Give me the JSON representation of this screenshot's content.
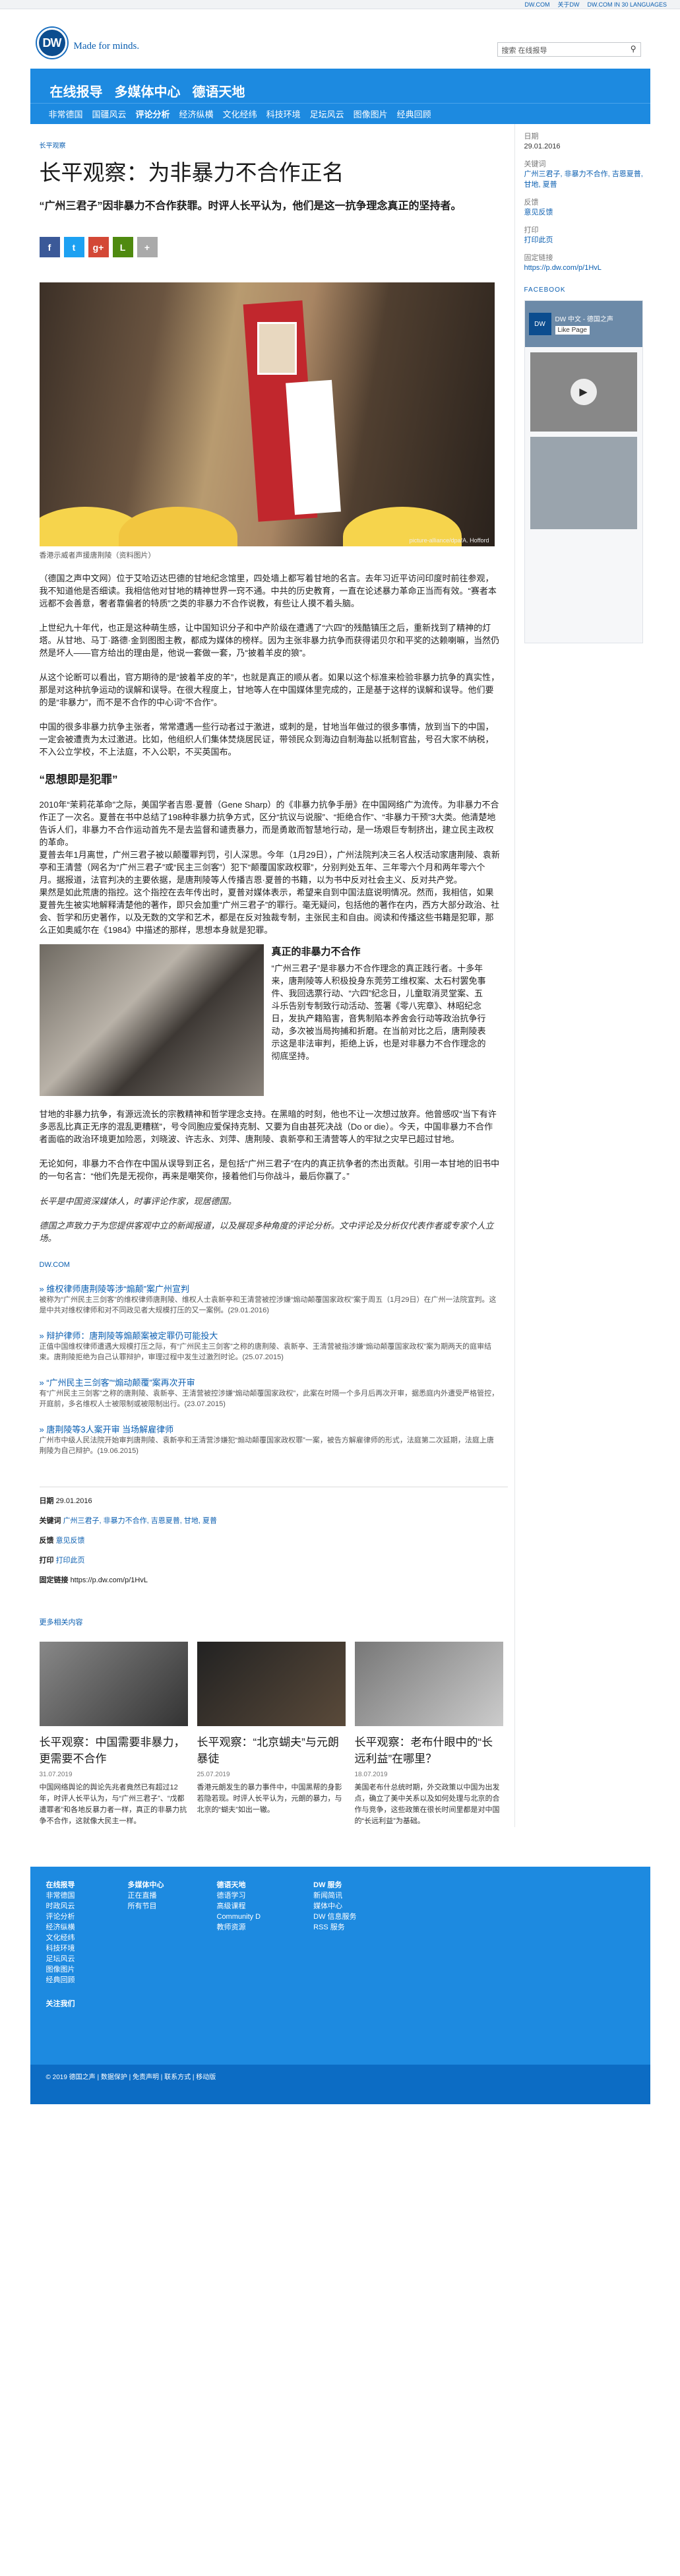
{
  "topbar": {
    "links": [
      "DW.COM",
      "关于DW",
      "DW.COM IN 30 LANGUAGES"
    ]
  },
  "header": {
    "logo": "DW",
    "tagline": "Made for minds.",
    "search_placeholder": "搜索 在线报导"
  },
  "nav": {
    "main": [
      "在线报导",
      "多媒体中心",
      "德语天地"
    ],
    "sub": [
      "非常德国",
      "国疆风云",
      "评论分析",
      "经济纵横",
      "文化经纬",
      "科技环境",
      "足坛风云",
      "图像图片",
      "经典回顾"
    ]
  },
  "article": {
    "kicker": "长平观察",
    "title": "长平观察：为非暴力不合作正名",
    "lead": "“广州三君子”因非暴力不合作获罪。时评人长平认为，他们是这一抗争理念真正的坚持者。",
    "img_caption": "picture-alliance/dpa/A. Hofford",
    "caption": "香港示威者声援唐荆陵（资料图片）",
    "p1": "（德国之声中文网）位于艾哈迈达巴德的甘地纪念馆里，四处墙上都写着甘地的名言。去年习近平访问印度时前往参观，我不知道他是否细读。我相信他对甘地的精神世界一窍不通。中共的历史教育，一直在论述暴力革命正当而有效。“赛者本远都不会善意，奢者靠偏者的特质”之类的非暴力不合作说教，有些让人摸不着头脑。",
    "p2": "上世纪九十年代，也正是这种萌生感，让中国知识分子和中产阶级在遭遇了“六四”的残酷镇压之后，重新找到了精神的灯塔。从甘地、马丁·路德·金到图图主教，都成为媒体的榜样。因为主张非暴力抗争而获得诺贝尔和平奖的达赖喇嘛，当然仍然是坏人——官方给出的理由是，他说一套做一套，乃“披着羊皮的狼”。",
    "p3": "从这个论断可以看出，官方期待的是“披着羊皮的羊”，也就是真正的顺从者。如果以这个标准来检验非暴力抗争的真实性，那是对这种抗争运动的误解和误导。在很大程度上，甘地等人在中国媒体里完成的，正是基于这样的误解和误导。他们要的是“非暴力”，而不是不合作的中心词“不合作”。",
    "p4": "中国的很多非暴力抗争主张者，常常遭遇一些行动者过于激进，或刺的是，甘地当年做过的很多事情，放到当下的中国，一定会被遭责为太过激进。比如，他组织人们集体焚烧居民证，带领民众到海边自制海盐以抵制官盐，号召大家不纳税，不入公立学校，不上法庭，不入公职，不买英国布。",
    "h_sub": "“思想即是犯罪”",
    "p5": "2010年“茉莉花革命”之际，美国学者吉恩·夏普（Gene Sharp）的《非暴力抗争手册》在中国网络广为流传。为非暴力不合作正了一次名。夏普在书中总结了198种非暴力抗争方式，区分“抗议与说服”、“拒绝合作”、“非暴力干预”3大类。他清楚地告诉人们，非暴力不合作运动首先不是去监督和谴责暴力，而是勇敢而智慧地行动，是一场艰巨专制挤出，建立民主政权的革命。",
    "p6": "夏普去年1月离世，广州三君子被以颠覆罪判罚，引人深思。今年（1月29日），广州法院判决三名人权活动家唐荆陵、袁新亭和王清营（网名为“广州三君子”或“民主三剑客”）犯下“颠覆国家政权罪”，分别判处五年、三年零六个月和两年零六个月。据报道，法官判决的主要依据，是唐荆陵等人传播吉恩·夏普的书籍，以为书中反对社会主义、反对共产党。",
    "p7": "果然是如此荒唐的指控。这个指控在去年传出时，夏普对媒体表示，希望来自到中国法庭说明情况。然而，我相信，如果夏普先生被实地解释清楚他的著作，即只会加重“广州三君子”的罪行。毫无疑问，包括他的著作在内，西方大部分政治、社会、哲学和历史著作，以及无数的文学和艺术，都是在反对独裁专制，主张民主和自由。阅读和传播这些书籍是犯罪，那么正如奥威尔在《1984》中描述的那样，思想本身就是犯罪。",
    "inset_title": "真正的非暴力不合作",
    "inset_text": "“广州三君子”是非暴力不合作理念的真正践行者。十多年来，唐荆陵等人积极投身东莞劳工维权案、太石村罢免事件、我回选票行动、“六四”纪念日，儿童取消灵堂案、五斗乐告别专制致行动活动、签署《零八宪章》、林昭纪念日，发执产籍陷害，音隽制陷本养舍会行动等政治抗争行动，多次被当局拘捕和折磨。在当前对比之后，唐荆陵表示这是非法审判，拒绝上诉，也是对非暴力不合作理念的彻底坚持。",
    "p8": "甘地的非暴力抗争，有源远流长的宗教精神和哲学理念支持。在黑暗的时刻，他也不让一次想过放弃。他曾感叹“当下有许多恶乱比真正无序的混乱更糟糕”，号令同胞应爱保持克制、又要为自由甚死决战（Do or die）。今天，中国非暴力不合作者面临的政治环境更加险恶，刘晓波、许志永、刘萍、唐荆陵、袁新亭和王清营等人的牢狱之灾早已超过甘地。",
    "p9": "无论如何，非暴力不合作在中国从误导到正名，是包括“广州三君子”在内的真正抗争者的杰出贡献。引用一本甘地的旧书中的一句名言：“他们先是无视你，再来是嘲笑你，接着他们与你战斗，最后你赢了。”",
    "author1": "长平是中国资深媒体人，时事评论作家，现居德国。",
    "author2": "德国之声致力于为您提供客观中立的新闻报道，以及展现多种角度的评论分析。文中评论及分析仅代表作者或专家个人立场。",
    "dwlink": "DW.COM"
  },
  "related": [
    {
      "title": "» 维权律师唐荆陵等涉“煽颠”案广州宣判",
      "text": "被称为“广州民主三剑客”的维权律师唐荆陵、维权人士袁新亭和王清营被控涉嫌“煽动颠覆国家政权”案于周五（1月29日）在广州一法院宣判。这是中共对维权律师和对不同政见者大规模打压的又一案例。(29.01.2016)"
    },
    {
      "title": "» 辩护律师：唐荆陵等煽颠案被定罪仍可能投大",
      "text": "正值中国维权律师遭遇大规模打压之际，有“广州民主三剑客”之称的唐荆陵、袁新亭、王清营被指涉嫌“煽动颠覆国家政权”案为期两天的庭审结束。唐荆陵拒绝为自己认罪辩护，审理过程中发生过激烈时论。(25.07.2015)"
    },
    {
      "title": "» “广州民主三剑客”“煽动颠覆”案再次开审",
      "text": "有“广州民主三剑客”之称的唐荆陵、袁新亭、王清营被控涉嫌“煽动颠覆国家政权”，此案在时隔一个多月后再次开审，据悉庭内外遭受严格管控，开庭前，多名维权人士被限制或被限制出行。(23.07.2015)"
    },
    {
      "title": "» 唐荆陵等3人案开审 当场解雇律师",
      "text": "广州市中级人民法院开始审判唐荆陵、袁新亭和王清营涉嫌犯“煽动颠覆国家政权罪”一案，被告方解雇律师的形式，法庭第二次延期，法庭上唐荆陵为自己辩护。(19.06.2015)"
    }
  ],
  "meta": {
    "date_label": "日期",
    "date": "29.01.2016",
    "kw_label": "关键词",
    "keywords": "广州三君子, 非暴力不合作, 吉恩夏普, 甘地, 夏普",
    "fb_label": "反馈",
    "fb": "意见反馈",
    "print_label": "打印",
    "print": "打印此页",
    "link_label": "固定链接",
    "link": "https://p.dw.com/p/1HvL"
  },
  "more_label": "更多相关内容",
  "cards": [
    {
      "title": "长平观察：中国需要非暴力，更需要不合作",
      "date": "31.07.2019",
      "text": "中国网络舆论的舆论先兆者竟然已有超过12年，时评人长平认为，与“广州三君子”、“戊都遭罪者”和各地反暴力者一样，真正的非暴力抗争不合作，这就像大民主一样。"
    },
    {
      "title": "长平观察：“北京蝴夫”与元朗暴徒",
      "date": "25.07.2019",
      "text": "香港元朗发生的暴力事件中，中国黑帮的身影若隐若现。时评人长平认为，元朗的暴力，与北京的“蝴夫”如出一辙。"
    },
    {
      "title": "长平观察：老布什眼中的“长远利益”在哪里？",
      "date": "18.07.2019",
      "text": "美国老布什总统时期，外交政策以中国为出发点，确立了美中关系以及如何处理与北京的合作与竞争，这些政策在很长时间里都是对中国的“长远利益”为基础。"
    }
  ],
  "sidebar": {
    "date_label": "日期",
    "date": "29.01.2016",
    "kw_label": "关键词",
    "keywords": "广州三君子, 非暴力不合作, 吉恩夏普, 甘地, 夏普",
    "fb_label": "反馈",
    "fb": "意见反馈",
    "print_label": "打印",
    "print": "打印此页",
    "link_label": "固定链接",
    "link": "https://p.dw.com/p/1HvL",
    "facebook": "FACEBOOK",
    "fb_page": "DW 中文 - 德国之声",
    "fb_like": "Like Page"
  },
  "footer": {
    "cols": [
      [
        "在线报导",
        "非常德国",
        "时政风云",
        "评论分析",
        "经济纵横",
        "文化经纬",
        "科技环境",
        "足坛风云",
        "图像图片",
        "经典回顾"
      ],
      [
        "多媒体中心",
        "正在直播",
        "所有节目"
      ],
      [
        "德语天地",
        "德语学习",
        "高级课程",
        "Community D",
        "教师资源"
      ],
      [
        "DW 服务",
        "新闻简讯",
        "媒体中心",
        "DW 信息服务",
        "RSS 服务"
      ]
    ],
    "social": "关注我们",
    "copyright": "© 2019 德国之声 | 数据保护 | 免责声明 | 联系方式 | 移动版"
  }
}
